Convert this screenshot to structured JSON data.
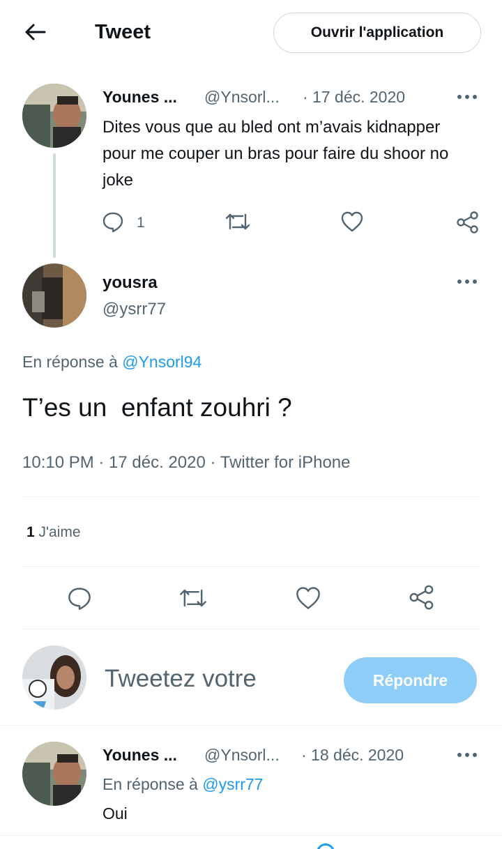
{
  "header": {
    "title": "Tweet",
    "open_app_label": "Ouvrir l'application"
  },
  "parent_tweet": {
    "name": "Younes ...",
    "handle": "@Ynsorl...",
    "date": "· 17 déc. 2020",
    "text": "Dites vous que au bled ont m’avais kidnapper pour me couper un bras pour faire du shoor no joke",
    "reply_count": "1"
  },
  "main_tweet": {
    "name": "yousra",
    "handle": "@ysrr77",
    "reply_to_prefix": "En réponse à",
    "reply_to_handle": "@Ynsorl94",
    "text": "T’es un  enfant zouhri ?",
    "meta": "10:10 PM · 17 déc. 2020 · Twitter for iPhone",
    "like_count": "1",
    "like_label": "J'aime"
  },
  "composer": {
    "placeholder": "Tweetez votre",
    "reply_button": "Répondre"
  },
  "reply_tweet": {
    "name": "Younes ...",
    "handle": "@Ynsorl...",
    "date": "· 18 déc. 2020",
    "reply_to_prefix": "En réponse à",
    "reply_to_handle": "@ysrr77",
    "text": "Oui"
  },
  "colors": {
    "accent": "#1d9bf0",
    "reply_button_disabled": "#8ecdf8",
    "muted_text": "#536471",
    "thread_line": "#cfd9de"
  }
}
